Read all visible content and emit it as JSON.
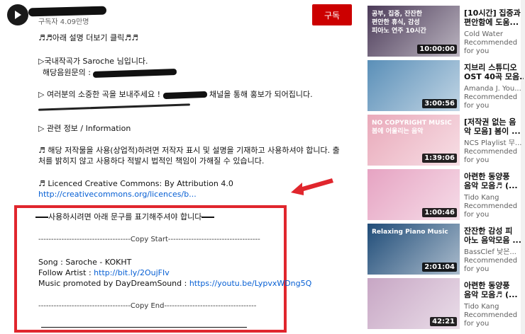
{
  "channel": {
    "subscriber_count": "구독자 4.09만명",
    "subscribe_label": "구독"
  },
  "description": {
    "line_more": "♬♬아래 설명 더보기 클릭♬♬",
    "line_composer": "▷국내작곡가 Saroche 님입니다.",
    "line_inquiry": "해당음원문의 : ",
    "line_submit_prefix": "▷ 여러분의 소중한 곡을 보내주세요 ! ",
    "line_submit_suffix": "채널을 통해 홍보가 되어집니다.",
    "line_info": "▷ 관련 정보 / Information",
    "line_usage_1": "♬ 해당 저작물을 사용(상업적)하려면  저작자 표시 및 설명을 기재하고 사용하셔야 합니다. 출",
    "line_usage_2": "처를 밝히지 않고 사용하다 적발시 법적인 책임이 가해질 수 있습니다.",
    "line_license": "♬ Licenced Creative Commons: By Attribution 4.0",
    "license_link": "http://creativecommons.org/licences/b..."
  },
  "notice": {
    "heading": "사용하시려면 아래 문구를 표기해주셔야 합니다",
    "copy_start": "------------------------------------Copy Start------------------------------------",
    "song": "Song : Saroche - KOKHT",
    "follow_label": "Follow Artist : ",
    "follow_link": "http://bit.ly/2OujFIv",
    "promo_label": "Music promoted by DayDreamSound : ",
    "promo_link": "https://youtu.be/LypvxWDng5Q",
    "copy_end": "------------------------------------Copy End------------------------------------"
  },
  "recommendations": [
    {
      "title": "[10시간] 집중과",
      "title2": "편안함에 도움...",
      "channel": "Cold Water",
      "meta": "Recommended",
      "meta2": "for you",
      "duration": "10:00:00",
      "thumb_text": "공부, 집중, 잔잔한\n편안한 휴식, 감성\n피아노 연주 10시간",
      "color": "#4b3a58"
    },
    {
      "title": "지브리 스튜디오",
      "title2": "OST 40곡 모음...",
      "channel": "Amanda J. You...",
      "meta": "Recommended",
      "meta2": "for you",
      "duration": "3:00:56",
      "thumb_text": "",
      "color": "#5a8fb8"
    },
    {
      "title": "[저작권 없는 음",
      "title2": "악 모음] 봄이 ...",
      "channel": "NCS Playlist 무...",
      "meta": "Recommended",
      "meta2": "for you",
      "duration": "1:39:06",
      "thumb_text": "NO COPYRIGHT MUSIC\n봄에 어울리는 음악",
      "color": "#e9a9ba"
    },
    {
      "title": "아련한 동양풍",
      "title2": "음악 모음♬ (...",
      "channel": "Tido Kang",
      "meta": "Recommended",
      "meta2": "for you",
      "duration": "1:00:46",
      "thumb_text": "",
      "color": "#e6a3c2"
    },
    {
      "title": "잔잔한 감성 피",
      "title2": "아노 음악모음 ...",
      "channel": "BassClef 낮은...",
      "meta": "Recommended",
      "meta2": "for you",
      "duration": "2:01:04",
      "thumb_text": "Relaxing Piano Music",
      "color": "#1f4c78"
    },
    {
      "title": "아련한 동양풍",
      "title2": "음악 모음♬ (...",
      "channel": "Tido Kang",
      "meta": "Recommended",
      "meta2": "for you",
      "duration": "42:21",
      "thumb_text": "",
      "color": "#c7a6c4"
    }
  ],
  "colors": {
    "subscribe": "#cc0000",
    "link": "#065fd4",
    "highlight_box": "#e0262d"
  }
}
